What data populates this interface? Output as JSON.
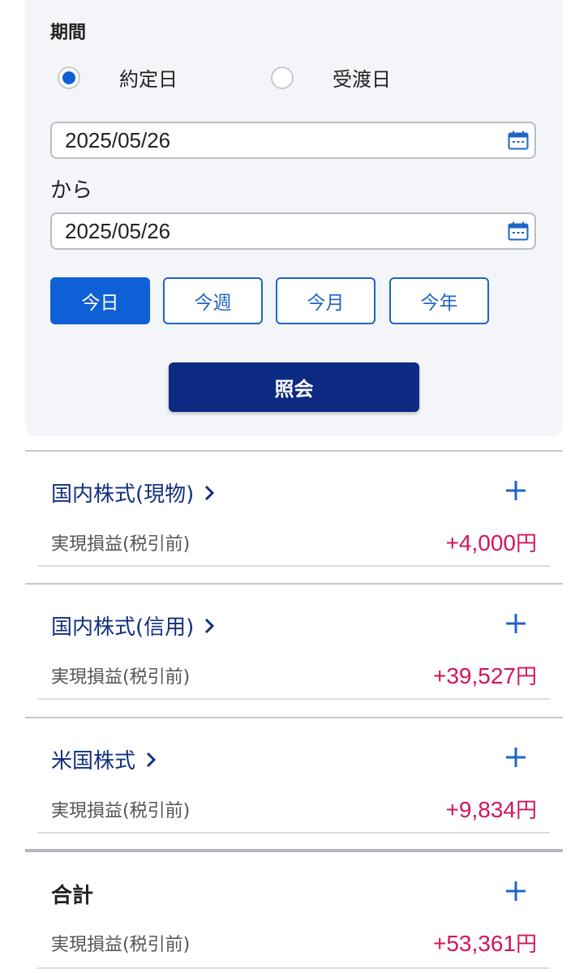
{
  "period": {
    "title": "期間",
    "radio_options": [
      {
        "label": "約定日",
        "checked": true
      },
      {
        "label": "受渡日",
        "checked": false
      }
    ],
    "date_from": "2025/05/26",
    "from_label": "から",
    "date_to": "2025/05/26",
    "quick_buttons": [
      {
        "label": "今日",
        "active": true
      },
      {
        "label": "今週",
        "active": false
      },
      {
        "label": "今月",
        "active": false
      },
      {
        "label": "今年",
        "active": false
      }
    ],
    "search_label": "照会"
  },
  "sections": [
    {
      "title": "国内株式(現物)",
      "pl_label": "実現損益(税引前)",
      "pl_value": "+4,000",
      "unit": "円"
    },
    {
      "title": "国内株式(信用)",
      "pl_label": "実現損益(税引前)",
      "pl_value": "+39,527",
      "unit": "円"
    },
    {
      "title": "米国株式",
      "pl_label": "実現損益(税引前)",
      "pl_value": "+9,834",
      "unit": "円"
    }
  ],
  "total": {
    "title": "合計",
    "pl_label": "実現損益(税引前)",
    "pl_value": "+53,361",
    "unit": "円"
  },
  "colors": {
    "accent": "#0f5fd6",
    "navy": "#0e2b83",
    "profit": "#d4145a"
  },
  "icons": [
    "calendar-icon",
    "chevron-right-icon",
    "plus-icon"
  ]
}
